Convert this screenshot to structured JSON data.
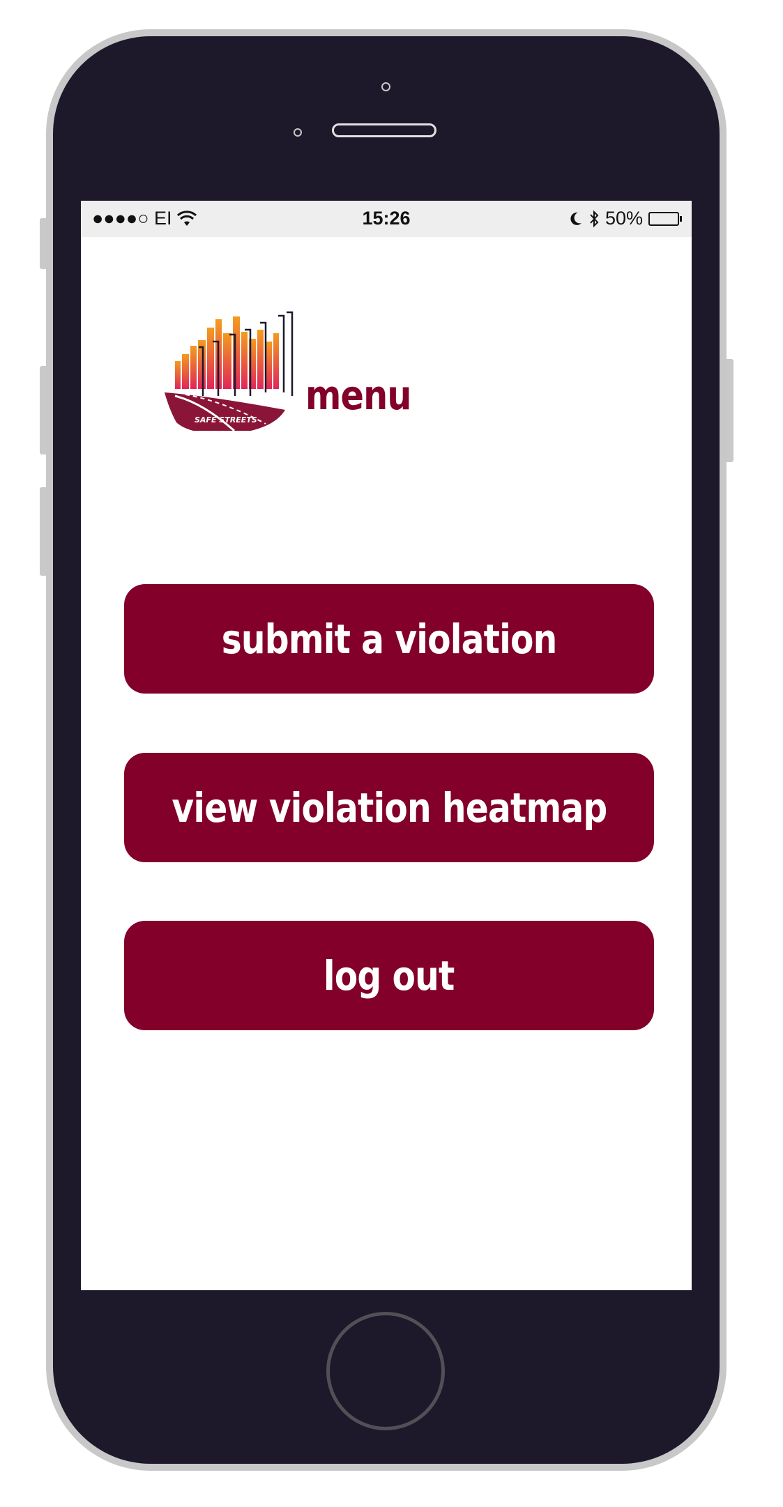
{
  "status_bar": {
    "carrier": "●●●●○ EI",
    "time": "15:26",
    "battery_percent": "50%",
    "battery_level": 0.5,
    "icons": [
      "signal-dots-icon",
      "wifi-icon",
      "moon-icon",
      "bluetooth-icon",
      "battery-icon"
    ]
  },
  "logo": {
    "text": "SAFE STREETS",
    "colors": {
      "road": "#8a1538",
      "skyline_top": "#f39c1f",
      "skyline_bottom": "#e0265a"
    }
  },
  "header": {
    "title": "menu"
  },
  "menu": {
    "items": [
      {
        "label": "submit a violation"
      },
      {
        "label": "view violation heatmap"
      },
      {
        "label": "log out"
      }
    ]
  },
  "colors": {
    "brand": "#820029",
    "phone_body": "#1d192b",
    "status_bar_bg": "#eeeeee"
  }
}
